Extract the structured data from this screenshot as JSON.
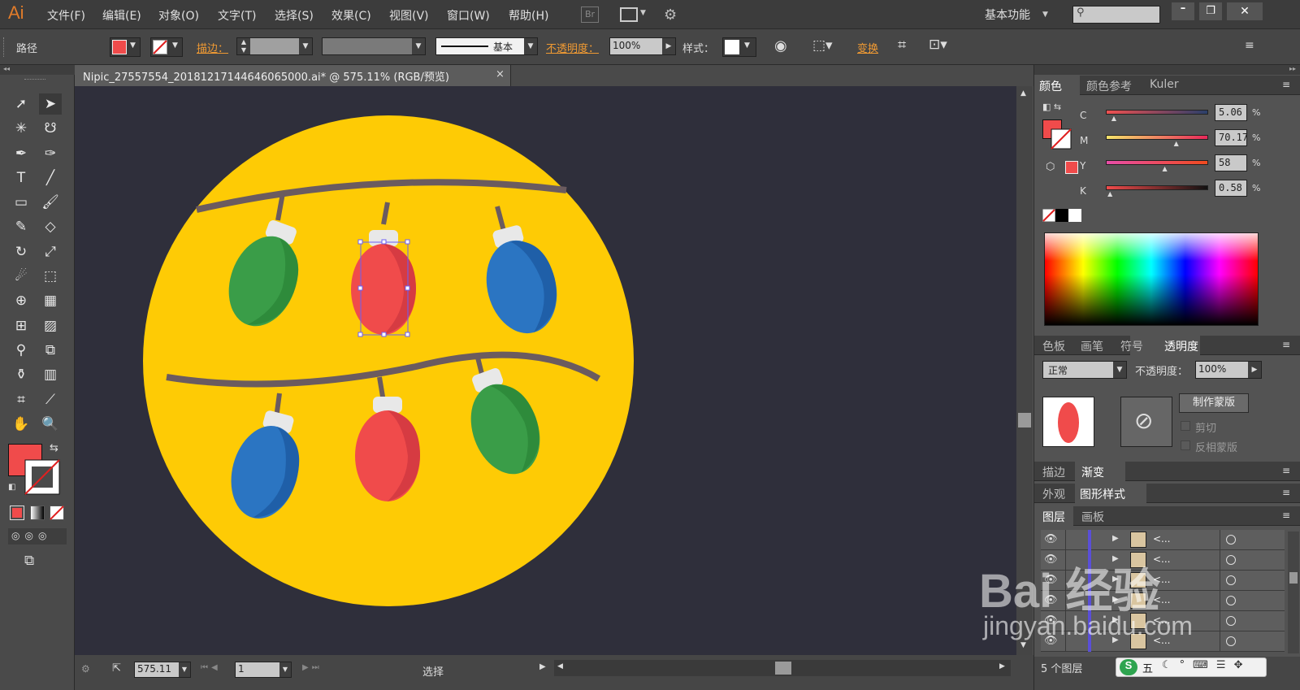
{
  "app": {
    "logo": "Ai",
    "workspace": "基本功能"
  },
  "menu": [
    "文件(F)",
    "编辑(E)",
    "对象(O)",
    "文字(T)",
    "选择(S)",
    "效果(C)",
    "视图(V)",
    "窗口(W)",
    "帮助(H)"
  ],
  "top_icons": {
    "bridge": "Br"
  },
  "control": {
    "selection_label": "路径",
    "stroke_label": "描边：",
    "stroke_style": "基本",
    "opacity_label": "不透明度：",
    "opacity_value": "100%",
    "style_label": "样式：",
    "transform_label": "变换",
    "fill_color": "#f04b4b"
  },
  "document": {
    "tab_title": "Nipic_27557554_20181217144646065000.ai* @ 575.11% (RGB/预览)",
    "close": "×"
  },
  "artwork": {
    "background": "#2f2f3b",
    "circle_color": "#fecb05",
    "wire_color": "#6b5b5f",
    "bulbs": [
      {
        "color": "#3a9d48",
        "shade": "#2e8b3b"
      },
      {
        "color": "#f04b4b",
        "shade": "#d63b42"
      },
      {
        "color": "#2b75c2",
        "shade": "#1f5fa8"
      },
      {
        "color": "#2b75c2",
        "shade": "#1f5fa8"
      },
      {
        "color": "#f04b4b",
        "shade": "#d63b42"
      },
      {
        "color": "#3a9d48",
        "shade": "#2e8b3b"
      }
    ]
  },
  "status": {
    "zoom": "575.11",
    "page": "1",
    "mode": "选择"
  },
  "color_panel": {
    "tabs": [
      "颜色",
      "颜色参考",
      "Kuler"
    ],
    "channels": [
      {
        "name": "C",
        "value": "5.06",
        "fraction": 0.05
      },
      {
        "name": "M",
        "value": "70.17",
        "fraction": 0.7
      },
      {
        "name": "Y",
        "value": "58",
        "fraction": 0.58
      },
      {
        "name": "K",
        "value": "0.58",
        "fraction": 0.01
      }
    ],
    "percent": "%"
  },
  "transparency_panel": {
    "tabs": [
      "色板",
      "画笔",
      "符号",
      "透明度"
    ],
    "blend_mode": "正常",
    "opacity_label": "不透明度：",
    "opacity_value": "100%",
    "make_mask": "制作蒙版",
    "clip": "剪切",
    "invert": "反相蒙版"
  },
  "stroke_gradient_tabs": [
    "描边",
    "渐变"
  ],
  "appearance_tabs": [
    "外观",
    "图形样式"
  ],
  "layers_panel": {
    "tabs": [
      "图层",
      "画板"
    ],
    "rows": [
      "<...",
      "<...",
      "<...",
      "<...",
      "<...",
      "<..."
    ],
    "count_label": "5 个图层"
  },
  "watermark": {
    "line1": "Bai 经验",
    "line2": "jingyan.baidu.com"
  },
  "ime": {
    "label": "五"
  }
}
